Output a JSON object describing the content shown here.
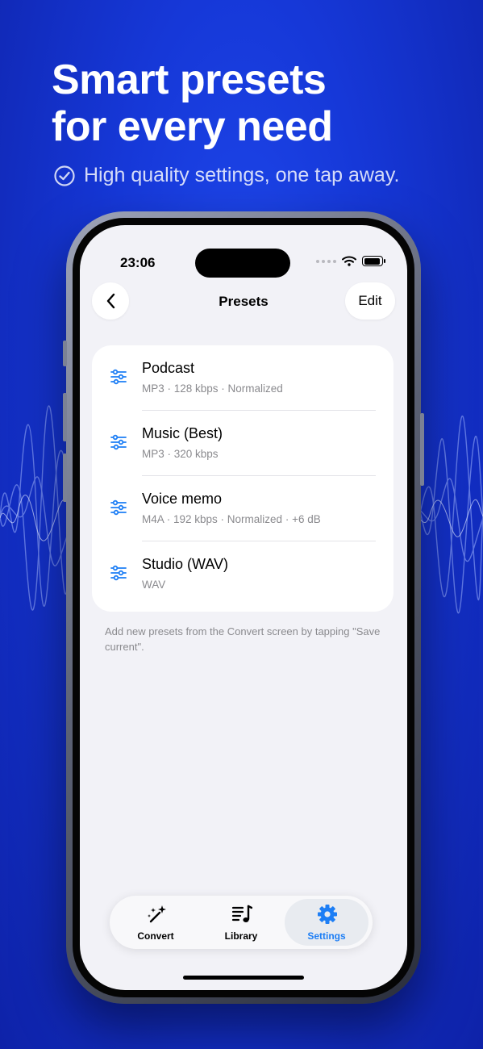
{
  "promo": {
    "headline_line1": "Smart presets",
    "headline_line2": "for every need",
    "subtitle": "High quality settings, one tap away."
  },
  "status_bar": {
    "time": "23:06"
  },
  "nav": {
    "title": "Presets",
    "edit_label": "Edit"
  },
  "presets": [
    {
      "name": "Podcast",
      "details": "MP3 · 128 kbps · Normalized"
    },
    {
      "name": "Music (Best)",
      "details": "MP3 · 320 kbps"
    },
    {
      "name": "Voice memo",
      "details": "M4A · 192 kbps · Normalized · +6 dB"
    },
    {
      "name": "Studio (WAV)",
      "details": "WAV"
    }
  ],
  "footnote": "Add new presets from the Convert screen by tapping \"Save current\".",
  "tabs": [
    {
      "label": "Convert",
      "icon": "magic-wand-icon",
      "active": false
    },
    {
      "label": "Library",
      "icon": "music-list-icon",
      "active": false
    },
    {
      "label": "Settings",
      "icon": "gear-icon",
      "active": true
    }
  ],
  "colors": {
    "background": "#1638d8",
    "accent": "#1d7ef5",
    "screen_background": "#f2f2f7"
  }
}
